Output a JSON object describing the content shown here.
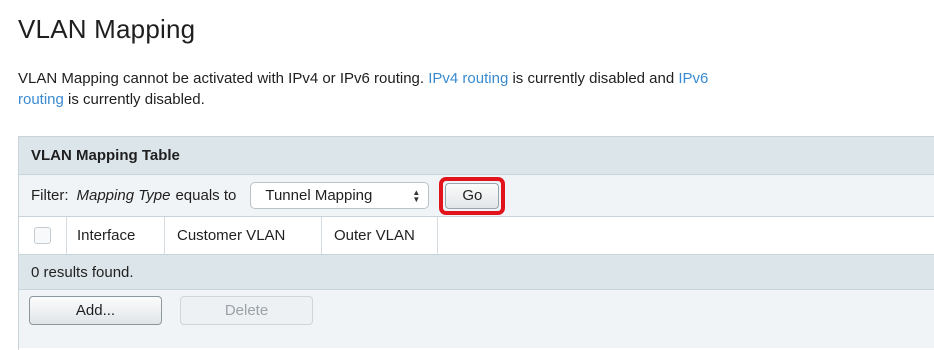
{
  "page": {
    "title": "VLAN Mapping",
    "notice": {
      "prefix": "VLAN Mapping cannot be activated with IPv4 or IPv6 routing. ",
      "ipv4_link": "IPv4 routing",
      "middle": " is currently disabled and ",
      "ipv6_link_part1": "IPv6",
      "ipv6_link_part2": "routing",
      "suffix": " is currently disabled."
    }
  },
  "table": {
    "title": "VLAN Mapping Table",
    "filter": {
      "label": "Filter:",
      "field": "Mapping Type",
      "operator": "equals to",
      "selected_value": "Tunnel Mapping",
      "go_label": "Go"
    },
    "columns": [
      "Interface",
      "Customer VLAN",
      "Outer VLAN"
    ],
    "results_text": "0 results found.",
    "buttons": {
      "add_label": "Add...",
      "delete_label": "Delete"
    }
  },
  "colors": {
    "link": "#3a8bd0",
    "highlight": "#e1141b",
    "header_bg": "#dce5ea"
  }
}
